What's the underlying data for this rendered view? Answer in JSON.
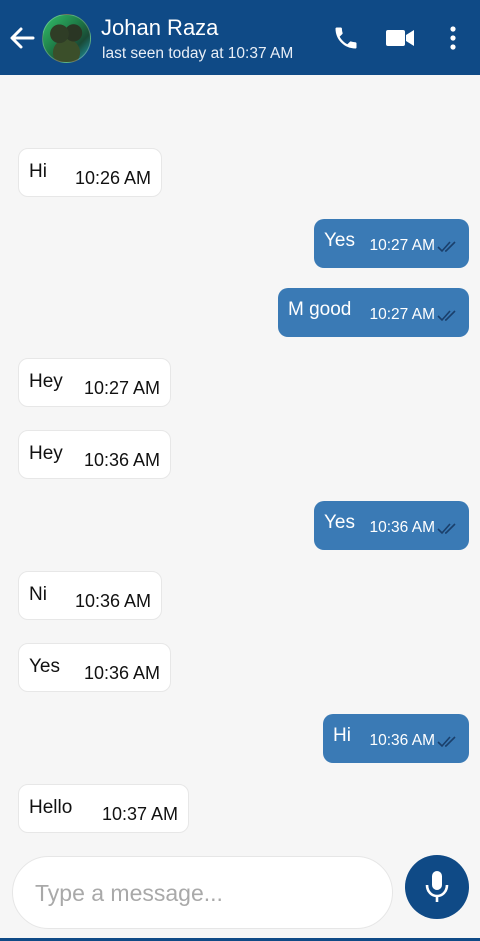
{
  "header": {
    "contact_name": "Johan Raza",
    "status": "last seen today at 10:37 AM",
    "icons": [
      "back-arrow-icon",
      "phone-icon",
      "video-call-icon",
      "more-vert-icon"
    ]
  },
  "messages": [
    {
      "dir": "in",
      "text": "Hi",
      "time": "10:26 AM"
    },
    {
      "dir": "out",
      "text": "Yes",
      "time": "10:27 AM",
      "read": true
    },
    {
      "dir": "out",
      "text": "M good",
      "time": "10:27 AM",
      "read": true
    },
    {
      "dir": "in",
      "text": "Hey",
      "time": "10:27 AM"
    },
    {
      "dir": "in",
      "text": "Hey",
      "time": "10:36 AM"
    },
    {
      "dir": "out",
      "text": "Yes",
      "time": "10:36 AM",
      "read": true
    },
    {
      "dir": "in",
      "text": "Ni",
      "time": "10:36 AM"
    },
    {
      "dir": "in",
      "text": "Yes",
      "time": "10:36 AM"
    },
    {
      "dir": "out",
      "text": "Hi",
      "time": "10:36 AM",
      "read": true
    },
    {
      "dir": "in",
      "text": "Hello",
      "time": "10:37 AM"
    }
  ],
  "composer": {
    "placeholder": "Type a message...",
    "value": ""
  },
  "colors": {
    "header": "#0f4a86",
    "outgoing_bubble": "#3a7ab5",
    "incoming_bubble": "#ffffff",
    "background": "#f6f6f6"
  }
}
